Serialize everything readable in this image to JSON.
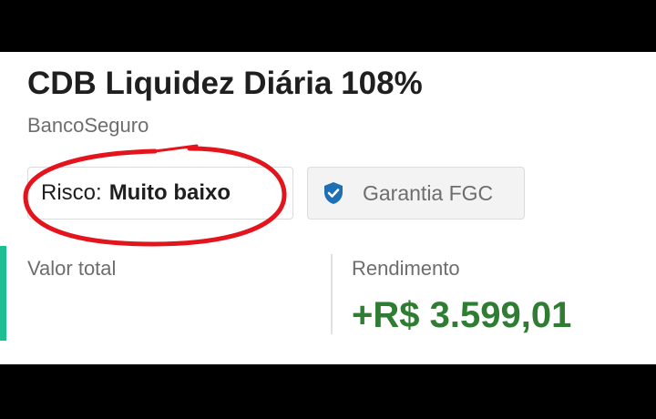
{
  "product": {
    "title": "CDB Liquidez Diária 108%",
    "issuer": "BancoSeguro"
  },
  "risk_chip": {
    "label": "Risco:",
    "value": "Muito baixo"
  },
  "guarantee_chip": {
    "icon": "shield-check-icon",
    "label": "Garantia FGC"
  },
  "stats": {
    "total_label": "Valor total",
    "yield_label": "Rendimento",
    "yield_value": "+R$ 3.599,01"
  },
  "colors": {
    "accent": "#1bbf91",
    "positive": "#2e7d32",
    "annotation": "#e3141b",
    "shield": "#1e6fb3"
  }
}
